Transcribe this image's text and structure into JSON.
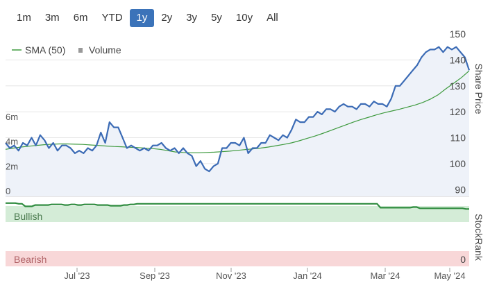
{
  "range_tabs": [
    "1m",
    "3m",
    "6m",
    "YTD",
    "1y",
    "2y",
    "3y",
    "5y",
    "10y",
    "All"
  ],
  "active_range": "1y",
  "legend": {
    "sma_label": "SMA (50)",
    "volume_label": "Volume"
  },
  "axis_labels": {
    "price": "Share Price",
    "rank": "StockRank"
  },
  "bands": {
    "bullish": "Bullish",
    "bearish": "Bearish",
    "bearish_value": "0"
  },
  "colors": {
    "price": "#3b6bb5",
    "sma": "#3e9a3e",
    "volume": "#c8c8c8",
    "rank": "#2e8b3e",
    "bullish_bg": "#d4ecd7",
    "bearish_bg": "#f8d7d8",
    "active_tab": "#3b73b9"
  },
  "chart_data": {
    "type": "line",
    "x_ticks": [
      "Jul '23",
      "Sep '23",
      "Nov '23",
      "Jan '24",
      "Mar '24",
      "May '24"
    ],
    "price_ticks": [
      90,
      100,
      110,
      120,
      130,
      140,
      150
    ],
    "volume_ticks": [
      "0",
      "2m",
      "4m",
      "6m"
    ],
    "price_ylim": [
      89,
      150
    ],
    "volume_ylim": [
      0,
      6
    ],
    "price": [
      108,
      106,
      107,
      105,
      108,
      107,
      110,
      107,
      111,
      109,
      106,
      108,
      105,
      107,
      107,
      106,
      104,
      105,
      104,
      106,
      105,
      107,
      112,
      108,
      116,
      114,
      114,
      110,
      106,
      107,
      106,
      105,
      106,
      105,
      107,
      107,
      108,
      106,
      105,
      106,
      104,
      106,
      104,
      103,
      99,
      101,
      98,
      97,
      99,
      100,
      106,
      106,
      108,
      108,
      107,
      110,
      104,
      106,
      106,
      108,
      108,
      111,
      110,
      109,
      111,
      110,
      113,
      117,
      116,
      116,
      118,
      118,
      120,
      119,
      121,
      121,
      120,
      122,
      123,
      122,
      122,
      121,
      123,
      123,
      122,
      124,
      123,
      123,
      122,
      125,
      130,
      130,
      132,
      134,
      136,
      138,
      141,
      143,
      144,
      144,
      145,
      143,
      145,
      144,
      145,
      143,
      141,
      136
    ],
    "sma": [
      105.5,
      106.0,
      106.4,
      106.7,
      107.0,
      107.3,
      107.5,
      107.6,
      107.6,
      107.5,
      107.4,
      107.2,
      107.0,
      106.8,
      106.6,
      106.5,
      106.3,
      106.2,
      106.0,
      105.8,
      105.5,
      105.0,
      104.5,
      104.3,
      104.2,
      104.2,
      104.3,
      104.4,
      104.6,
      104.8,
      105.1,
      105.4,
      105.7,
      106.0,
      106.4,
      106.9,
      107.4,
      108.0,
      108.8,
      109.7,
      110.6,
      111.6,
      112.7,
      113.8,
      114.9,
      116.0,
      117.0,
      117.9,
      118.8,
      119.6,
      120.3,
      121.0,
      121.8,
      122.6,
      123.6,
      124.9,
      126.6,
      128.9,
      131.0,
      133.2,
      135.8
    ],
    "volume": [
      0.4,
      0.3,
      1.2,
      0.5,
      3.7,
      0.6,
      0.4,
      2.8,
      0.5,
      0.4,
      0.6,
      0.3,
      0.5,
      0.4,
      0.3,
      0.5,
      1.1,
      0.4,
      0.3,
      0.6,
      0.4,
      0.5,
      0.3,
      0.4,
      0.6,
      0.5,
      0.4,
      1.0,
      0.4,
      0.3,
      0.6,
      0.5,
      0.4,
      0.3,
      0.6,
      0.4,
      0.5,
      1.6,
      0.4,
      0.3,
      0.5,
      0.4,
      0.6,
      0.3,
      0.5,
      0.4,
      1.2,
      0.5,
      0.4,
      0.3,
      1.3,
      0.5,
      0.4,
      0.6,
      0.3,
      0.5,
      0.4,
      1.7,
      0.6,
      0.5,
      0.4,
      0.3,
      0.8,
      0.4,
      0.5,
      0.6,
      0.4,
      0.3,
      0.5,
      0.4,
      0.6,
      0.7,
      0.4,
      0.5,
      0.6,
      0.3,
      1.1,
      1.7,
      0.4,
      0.5,
      0.6,
      0.3,
      0.4,
      0.5,
      0.6,
      0.4,
      0.5,
      0.4,
      1.0,
      0.6,
      0.5,
      1.0,
      0.4,
      0.3,
      0.5,
      0.6,
      0.4,
      0.5,
      2.0,
      0.6,
      4.4,
      1.2,
      0.5,
      0.6,
      0.4,
      0.3,
      0.5,
      0.4
    ],
    "stockrank": [
      97,
      97,
      97,
      97,
      96,
      96,
      92,
      92,
      92,
      94,
      94,
      94,
      94,
      94,
      95,
      95,
      95,
      95,
      94,
      94,
      95,
      95,
      94,
      94,
      95,
      95,
      95,
      95,
      94,
      94,
      94,
      94,
      93,
      93,
      93,
      93,
      94,
      94,
      95,
      95,
      96,
      96,
      96,
      96,
      96,
      96,
      96,
      96,
      96,
      96,
      96,
      96,
      96,
      96,
      96,
      96,
      96,
      96,
      96,
      96,
      96,
      96,
      96,
      96,
      96,
      96,
      96,
      96,
      96,
      96,
      96,
      96,
      96,
      96,
      96,
      96,
      96,
      96,
      96,
      96,
      96,
      96,
      96,
      96,
      96,
      96,
      96,
      96,
      96,
      96,
      96,
      96,
      96,
      96,
      96,
      96,
      96,
      96,
      96,
      96,
      96,
      96,
      96,
      96,
      96,
      96,
      96,
      96,
      96,
      96,
      96,
      96,
      96,
      96,
      90,
      90,
      90,
      90,
      90,
      90,
      90,
      90,
      90,
      90,
      91,
      91,
      89,
      89,
      89,
      89,
      89,
      89,
      89,
      89,
      89,
      89,
      89,
      89,
      89,
      89,
      88,
      88
    ]
  }
}
